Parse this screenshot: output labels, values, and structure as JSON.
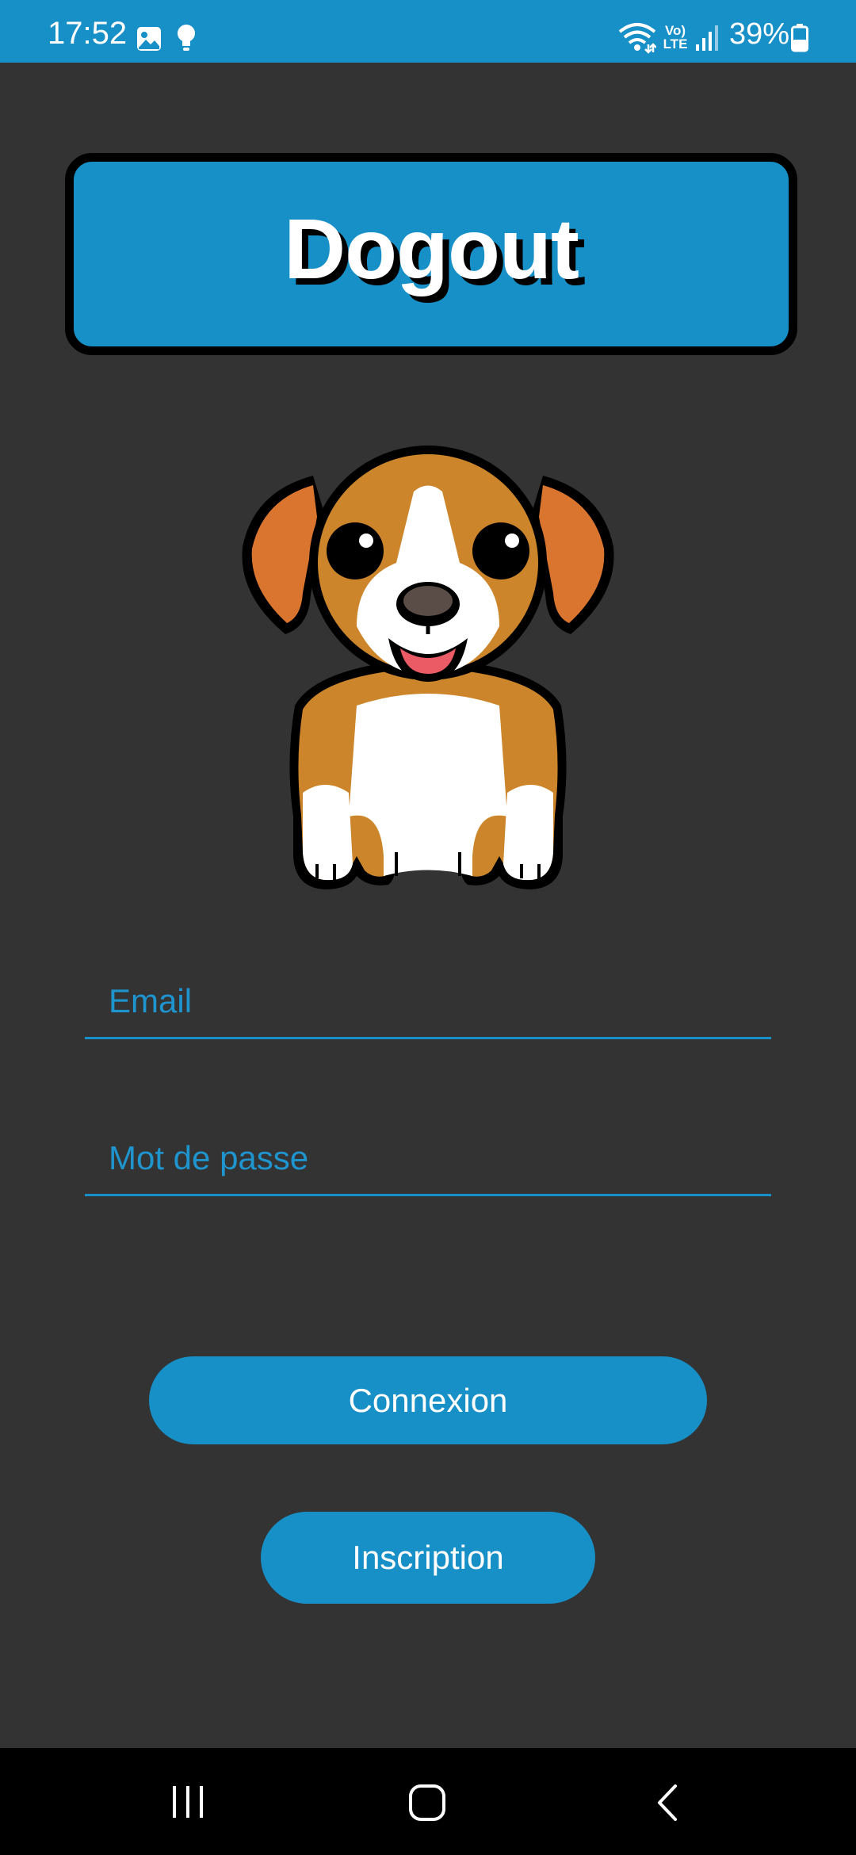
{
  "status_bar": {
    "time": "17:52",
    "volte_line1": "Vo)",
    "volte_line2": "LTE",
    "battery_percent": "39%",
    "icons": [
      "gallery-icon",
      "bulb-icon",
      "wifi-icon",
      "volte-icon",
      "signal-icon",
      "battery-icon"
    ],
    "background_color": "#178fc7"
  },
  "app": {
    "title": "Dogout",
    "accent_color": "#178fc7",
    "background_color": "#333333"
  },
  "form": {
    "email_placeholder": "Email",
    "email_value": "",
    "password_placeholder": "Mot de passe",
    "password_value": ""
  },
  "buttons": {
    "login_label": "Connexion",
    "signup_label": "Inscription"
  },
  "nav_bar": {
    "icons": [
      "recents-icon",
      "home-icon",
      "back-icon"
    ]
  }
}
